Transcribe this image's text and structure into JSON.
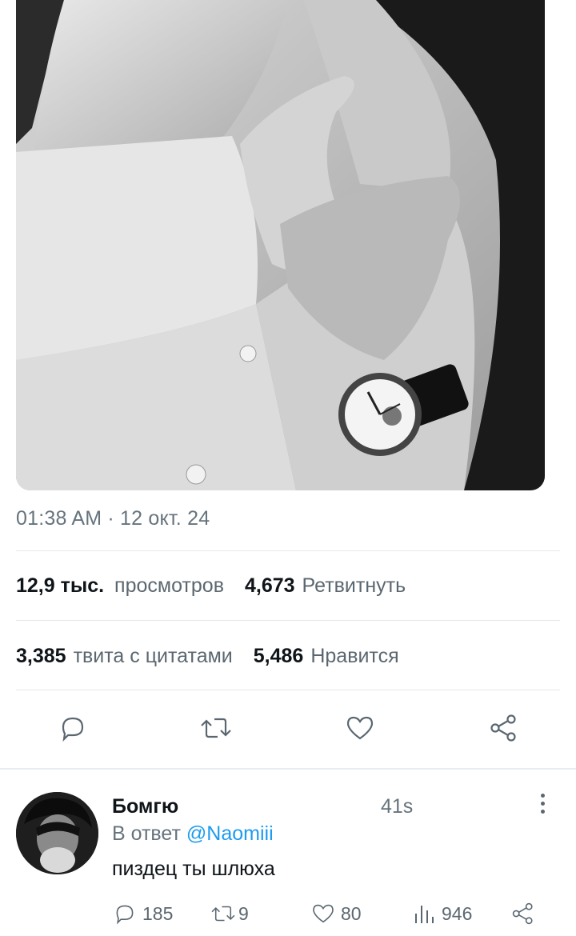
{
  "tweet": {
    "image": {
      "description_icon": "photo-hands-watch"
    },
    "timestamp": "01:38 AM · 12 окт. 24",
    "stats": {
      "views_count": "12,9 тыс.",
      "views_label": "просмотров",
      "retweets_count": "4,673",
      "retweets_label": "Ретвитнуть",
      "quotes_count": "3,385",
      "quotes_label": "твита с цитатами",
      "likes_count": "5,486",
      "likes_label": "Нравится"
    },
    "actions": {
      "reply_icon": "reply-icon",
      "retweet_icon": "retweet-icon",
      "like_icon": "heart-icon",
      "share_icon": "share-icon"
    }
  },
  "reply": {
    "username": "Бомгю",
    "time": "41s",
    "reply_prefix": "В ответ",
    "reply_handle": "@Naomiii",
    "text": "пиздец ты шлюха",
    "counts": {
      "replies": "185",
      "retweets": "9",
      "likes": "80",
      "views": "946"
    }
  },
  "colors": {
    "text": "#0f1419",
    "muted": "#66737d",
    "link": "#1d9bf0",
    "divider": "#e5e8eb"
  }
}
